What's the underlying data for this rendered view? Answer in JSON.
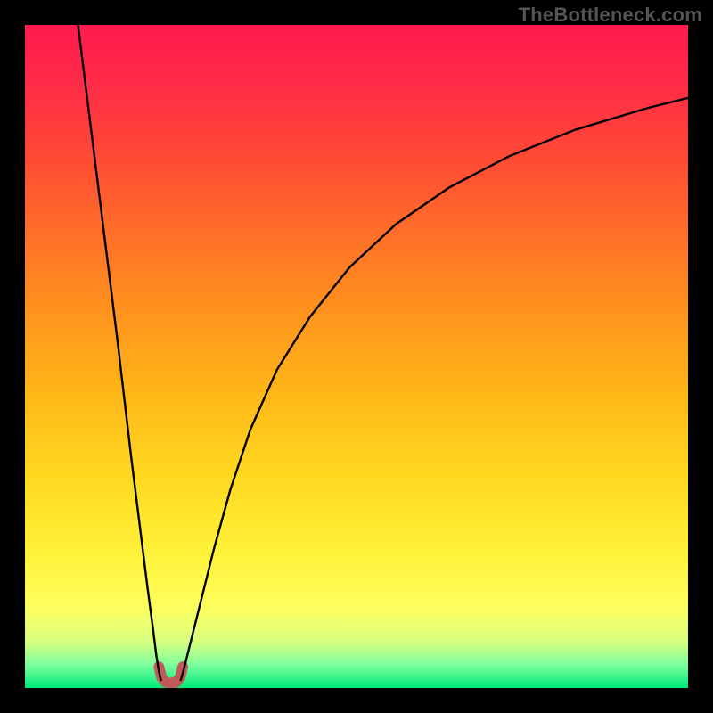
{
  "watermark": "TheBottleneck.com",
  "gradient": {
    "stops": [
      {
        "offset": 0.0,
        "color": "#ff1a4f"
      },
      {
        "offset": 0.08,
        "color": "#ff2a48"
      },
      {
        "offset": 0.18,
        "color": "#ff4438"
      },
      {
        "offset": 0.3,
        "color": "#ff6a2a"
      },
      {
        "offset": 0.42,
        "color": "#ff8f1f"
      },
      {
        "offset": 0.55,
        "color": "#ffb518"
      },
      {
        "offset": 0.68,
        "color": "#ffd820"
      },
      {
        "offset": 0.8,
        "color": "#fff23a"
      },
      {
        "offset": 0.88,
        "color": "#fdff60"
      },
      {
        "offset": 0.93,
        "color": "#d8ff80"
      },
      {
        "offset": 0.965,
        "color": "#7cff9c"
      },
      {
        "offset": 1.0,
        "color": "#00e87a"
      }
    ]
  },
  "chart_data": {
    "type": "line",
    "title": "",
    "xlabel": "",
    "ylabel": "",
    "xlim": [
      0,
      100
    ],
    "ylim": [
      0,
      100
    ],
    "series": [
      {
        "name": "left-branch",
        "x": [
          8,
          10,
          12,
          14,
          16,
          17.5,
          18.5,
          19.3,
          19.8,
          20.2,
          20.5
        ],
        "y": [
          100,
          84,
          68,
          52,
          35,
          23,
          15,
          9,
          5,
          2.5,
          1.2
        ]
      },
      {
        "name": "right-branch",
        "x": [
          23.5,
          24,
          25,
          26.5,
          28.5,
          31,
          34,
          38,
          43,
          49,
          56,
          64,
          73,
          83,
          94,
          100
        ],
        "y": [
          1.2,
          3,
          7,
          13,
          21,
          30,
          39,
          48,
          56,
          63.5,
          70,
          75.5,
          80.2,
          84.2,
          87.5,
          89
        ]
      },
      {
        "name": "valley-marker",
        "x": [
          20.2,
          20.6,
          21.2,
          22.0,
          22.8,
          23.4,
          23.8
        ],
        "y": [
          3.2,
          1.6,
          0.9,
          0.7,
          0.9,
          1.6,
          3.2
        ]
      }
    ],
    "annotations": [],
    "legend": []
  },
  "styles": {
    "curve_stroke": "#000000",
    "curve_width": 2.4,
    "marker_stroke": "#c05a5a",
    "marker_width": 12
  }
}
